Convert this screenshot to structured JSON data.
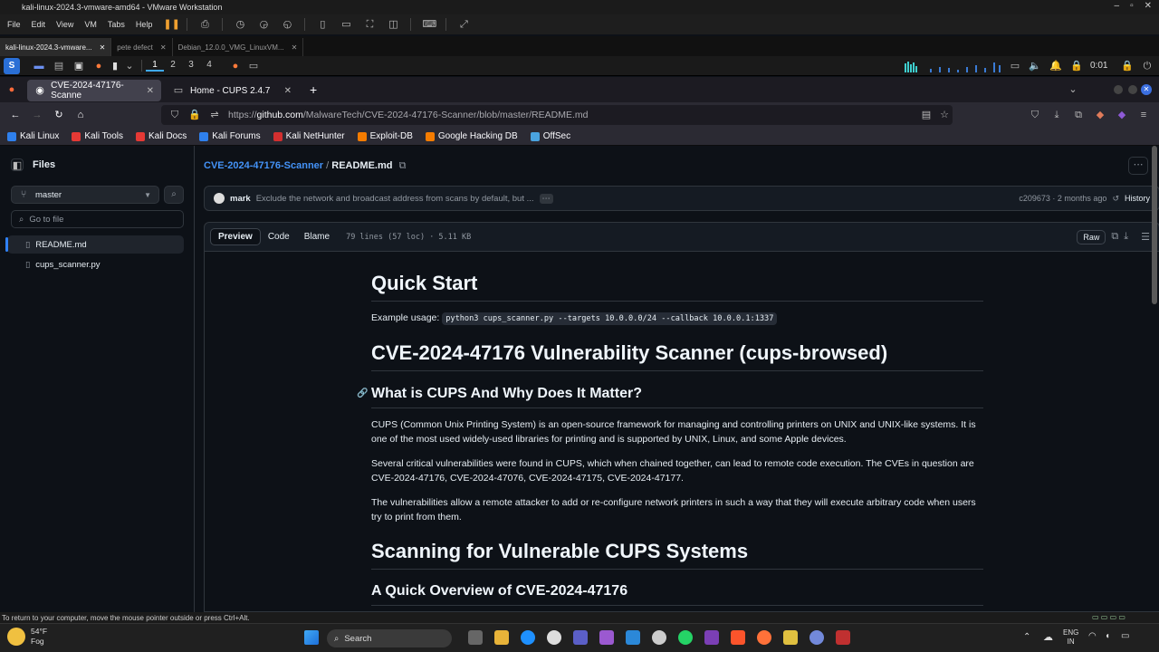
{
  "vmware": {
    "title": "kali-linux-2024.3-vmware-amd64 - VMware Workstation",
    "menu": [
      "File",
      "Edit",
      "View",
      "VM",
      "Tabs",
      "Help"
    ],
    "tabs": [
      {
        "label": "kali-linux-2024.3-vmware...",
        "active": true
      },
      {
        "label": "pete defect",
        "active": false
      },
      {
        "label": "Debian_12.0.0_VMG_LinuxVM...",
        "active": false
      }
    ],
    "status": "To return to your computer, move the mouse pointer outside or press Ctrl+Alt."
  },
  "kali_panel": {
    "workspaces": [
      "1",
      "2",
      "3",
      "4"
    ],
    "clock": "0:01"
  },
  "firefox": {
    "tabs": [
      {
        "label": "CVE-2024-47176-Scanne",
        "active": true
      },
      {
        "label": "Home - CUPS 2.4.7",
        "active": false
      }
    ],
    "new_tab": "+",
    "url_prefix": "https://",
    "url_host": "github.com",
    "url_path": "/MalwareTech/CVE-2024-47176-Scanner/blob/master/README.md",
    "bookmarks": [
      {
        "label": "Kali Linux",
        "color": "#2f80ed"
      },
      {
        "label": "Kali Tools",
        "color": "#e53935"
      },
      {
        "label": "Kali Docs",
        "color": "#e53935"
      },
      {
        "label": "Kali Forums",
        "color": "#2f80ed"
      },
      {
        "label": "Kali NetHunter",
        "color": "#d32f2f"
      },
      {
        "label": "Exploit-DB",
        "color": "#f57c00"
      },
      {
        "label": "Google Hacking DB",
        "color": "#f57c00"
      },
      {
        "label": "OffSec",
        "color": "#4aa3df"
      }
    ]
  },
  "sidebar": {
    "title": "Files",
    "branch": "master",
    "goto_placeholder": "Go to file",
    "files": [
      "README.md",
      "cups_scanner.py"
    ]
  },
  "main": {
    "repo": "CVE-2024-47176-Scanner",
    "sep": "/",
    "file": "README.md",
    "commit": {
      "author": "mark",
      "message": "Exclude the network and broadcast address from scans by default, but ...",
      "meta": "c209673 · 2 months ago",
      "history": "History"
    },
    "view_tabs": [
      "Preview",
      "Code",
      "Blame"
    ],
    "file_info": "79 lines (57 loc) · 5.11 KB",
    "raw": "Raw"
  },
  "readme": {
    "h_quick_start": "Quick Start",
    "example_label": "Example usage:",
    "example_code": "python3 cups_scanner.py --targets 10.0.0.0/24 --callback 10.0.0.1:1337",
    "h_scanner": "CVE-2024-47176 Vulnerability Scanner (cups-browsed)",
    "h_what_is": "What is CUPS And Why Does It Matter?",
    "p1": "CUPS (Common Unix Printing System) is an open-source framework for managing and controlling printers on UNIX and UNIX-like systems. It is one of the most used widely-used libraries for printing and is supported by UNIX, Linux, and some Apple devices.",
    "p2": "Several critical vulnerabilities were found in CUPS, which when chained together, can lead to remote code execution. The CVEs in question are CVE-2024-47176, CVE-2024-47076, CVE-2024-47175, CVE-2024-47177.",
    "p3": "The vulnerabilities allow a remote attacker to add or re-configure network printers in such a way that they will execute arbitrary code when users try to print from them.",
    "h_scanning": "Scanning for Vulnerable CUPS Systems",
    "h_overview": "A Quick Overview of CVE-2024-47176"
  },
  "taskbar": {
    "weather_temp": "54°F",
    "weather_desc": "Fog",
    "search": "Search",
    "lang": "ENG",
    "lang2": "IN"
  }
}
